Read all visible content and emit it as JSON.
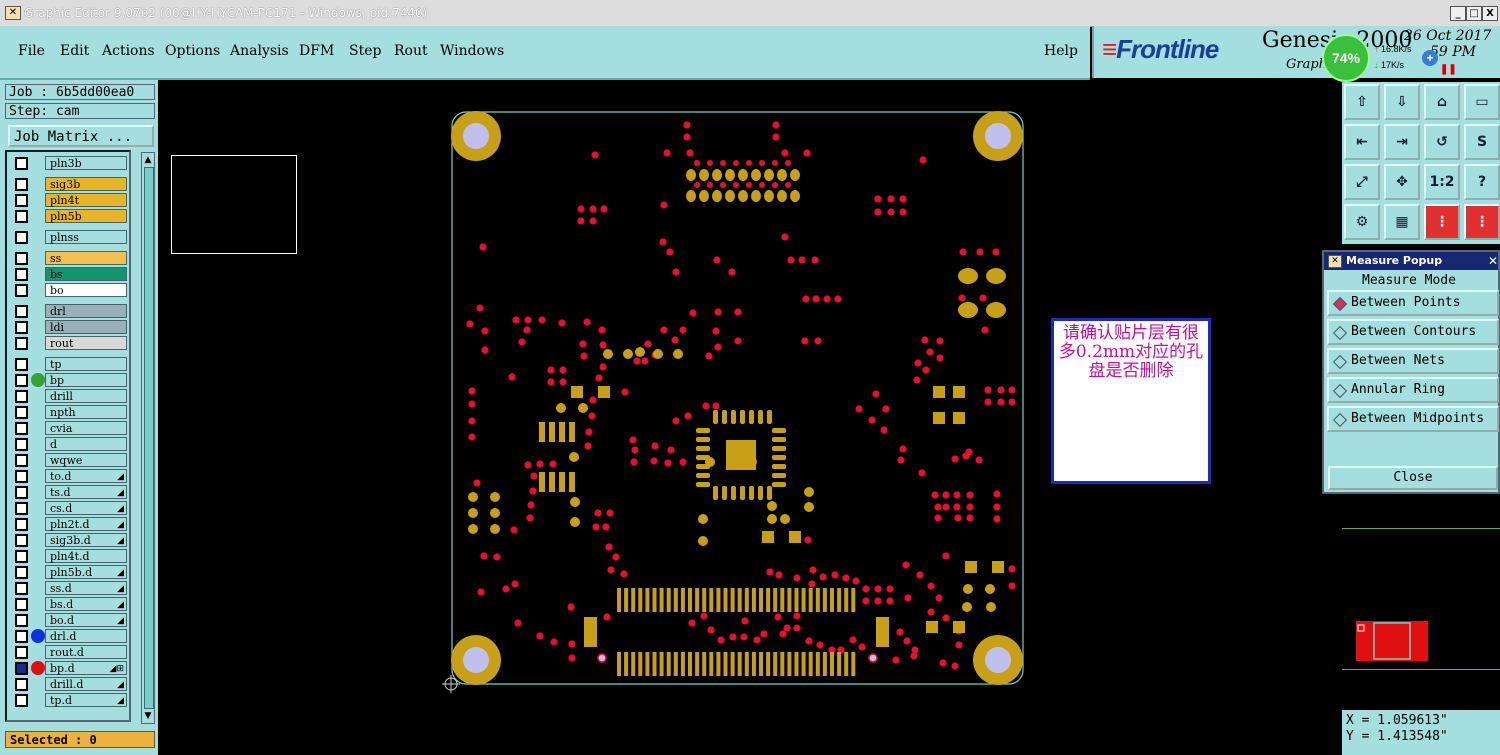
{
  "window": {
    "title": "Graphic Editor 9.07b2 (00@HY-HYCAM-PC171 - Windows, pid:7440)",
    "buttons": [
      "_",
      "□",
      "X"
    ]
  },
  "menu": {
    "items": [
      "File",
      "Edit",
      "Actions",
      "Options",
      "Analysis",
      "DFM",
      "Step",
      "Rout",
      "Windows"
    ],
    "help": "Help"
  },
  "brand": {
    "logo": "Frontline",
    "product": "Genesis 2000",
    "subtitle": "Graphi",
    "date": "26 Oct 2017",
    "time": "59 PM"
  },
  "network_widget": {
    "percent": "74%",
    "upload": "16.8K/s",
    "download": "17K/s"
  },
  "job": {
    "job_label": "Job : 6b5dd00ea0",
    "step_label": "Step: cam",
    "matrix_button": "Job Matrix ..."
  },
  "layers": [
    {
      "name": "pln3b",
      "color": "#a4dede",
      "dot": null,
      "mark": ""
    },
    {
      "name": "sig3b",
      "color": "#e8b428",
      "dot": null,
      "mark": ""
    },
    {
      "name": "pln4t",
      "color": "#e8b428",
      "dot": null,
      "mark": ""
    },
    {
      "name": "pln5b",
      "color": "#e8b428",
      "dot": null,
      "mark": ""
    },
    {
      "name": "plnss",
      "color": "#a4dede",
      "dot": null,
      "mark": ""
    },
    {
      "name": "ss",
      "color": "#f0c050",
      "dot": null,
      "mark": ""
    },
    {
      "name": "bs",
      "color": "#13946c",
      "dot": null,
      "mark": ""
    },
    {
      "name": "bo",
      "color": "#ffffff",
      "dot": null,
      "mark": ""
    },
    {
      "name": "drl",
      "color": "#9ab0b8",
      "dot": null,
      "mark": ""
    },
    {
      "name": "ldi",
      "color": "#9ab0b8",
      "dot": null,
      "mark": ""
    },
    {
      "name": "rout",
      "color": "#d8d8d8",
      "dot": null,
      "mark": ""
    },
    {
      "name": "tp",
      "color": "#a4dede",
      "dot": null,
      "mark": ""
    },
    {
      "name": "bp",
      "color": "#a4dede",
      "dot": "#38a038",
      "mark": ""
    },
    {
      "name": "drill",
      "color": "#a4dede",
      "dot": null,
      "mark": ""
    },
    {
      "name": "npth",
      "color": "#a4dede",
      "dot": null,
      "mark": ""
    },
    {
      "name": "cvia",
      "color": "#a4dede",
      "dot": null,
      "mark": ""
    },
    {
      "name": "d",
      "color": "#a4dede",
      "dot": null,
      "mark": ""
    },
    {
      "name": "wqwe",
      "color": "#a4dede",
      "dot": null,
      "mark": ""
    },
    {
      "name": "to.d",
      "color": "#a4dede",
      "dot": null,
      "mark": "◢"
    },
    {
      "name": "ts.d",
      "color": "#a4dede",
      "dot": null,
      "mark": "◢"
    },
    {
      "name": "cs.d",
      "color": "#a4dede",
      "dot": null,
      "mark": "◢"
    },
    {
      "name": "pln2t.d",
      "color": "#a4dede",
      "dot": null,
      "mark": "◢"
    },
    {
      "name": "sig3b.d",
      "color": "#a4dede",
      "dot": null,
      "mark": "◢"
    },
    {
      "name": "pln4t.d",
      "color": "#a4dede",
      "dot": null,
      "mark": ""
    },
    {
      "name": "pln5b.d",
      "color": "#a4dede",
      "dot": null,
      "mark": "◢"
    },
    {
      "name": "ss.d",
      "color": "#a4dede",
      "dot": null,
      "mark": "◢"
    },
    {
      "name": "bs.d",
      "color": "#a4dede",
      "dot": null,
      "mark": "◢"
    },
    {
      "name": "bo.d",
      "color": "#a4dede",
      "dot": null,
      "mark": "◢"
    },
    {
      "name": "drl.d",
      "color": "#a4dede",
      "dot": "#1030e0",
      "mark": ""
    },
    {
      "name": "rout.d",
      "color": "#a4dede",
      "dot": null,
      "mark": ""
    },
    {
      "name": "bp.d",
      "color": "#a4dede",
      "dot": "#e01010",
      "mark": "◢⊞"
    },
    {
      "name": "drill.d",
      "color": "#a4dede",
      "dot": null,
      "mark": "◢"
    },
    {
      "name": "tp.d",
      "color": "#a4dede",
      "dot": null,
      "mark": "◢"
    }
  ],
  "status": {
    "selected": "Selected : 0"
  },
  "toolbar": {
    "buttons": [
      "move-up-icon",
      "move-down-icon",
      "home-icon",
      "window-icon",
      "step-in-icon",
      "step-out-icon",
      "undo-icon",
      "snap-icon",
      "zoom-fit-icon",
      "zoom-center-icon",
      "ratio-icon",
      "help-icon",
      "settings-icon",
      "grid-icon",
      "layer-red-icon",
      "layer-red-2-icon"
    ],
    "labels": [
      "",
      "",
      "",
      "",
      "",
      "",
      "",
      "",
      "",
      "",
      "1:2",
      "?",
      "",
      "",
      "",
      ""
    ]
  },
  "measure_popup": {
    "title": "Measure Popup",
    "mode_label": "Measure Mode",
    "options": [
      "Between Points",
      "Between Contours",
      "Between Nets",
      "Annular Ring",
      "Between Midpoints"
    ],
    "selected": "Between Points",
    "close_label": "Close"
  },
  "coordinates": {
    "x": "X = 1.059613\"",
    "y": "Y = 1.413548\""
  },
  "note": {
    "text": "请确认贴片层有很多0.2mm对应的孔盘是否删除"
  },
  "colors": {
    "panel": "#a4dede",
    "pad": "#c8a018",
    "via": "#e8102e",
    "board_outline": "#7ccfcf"
  }
}
